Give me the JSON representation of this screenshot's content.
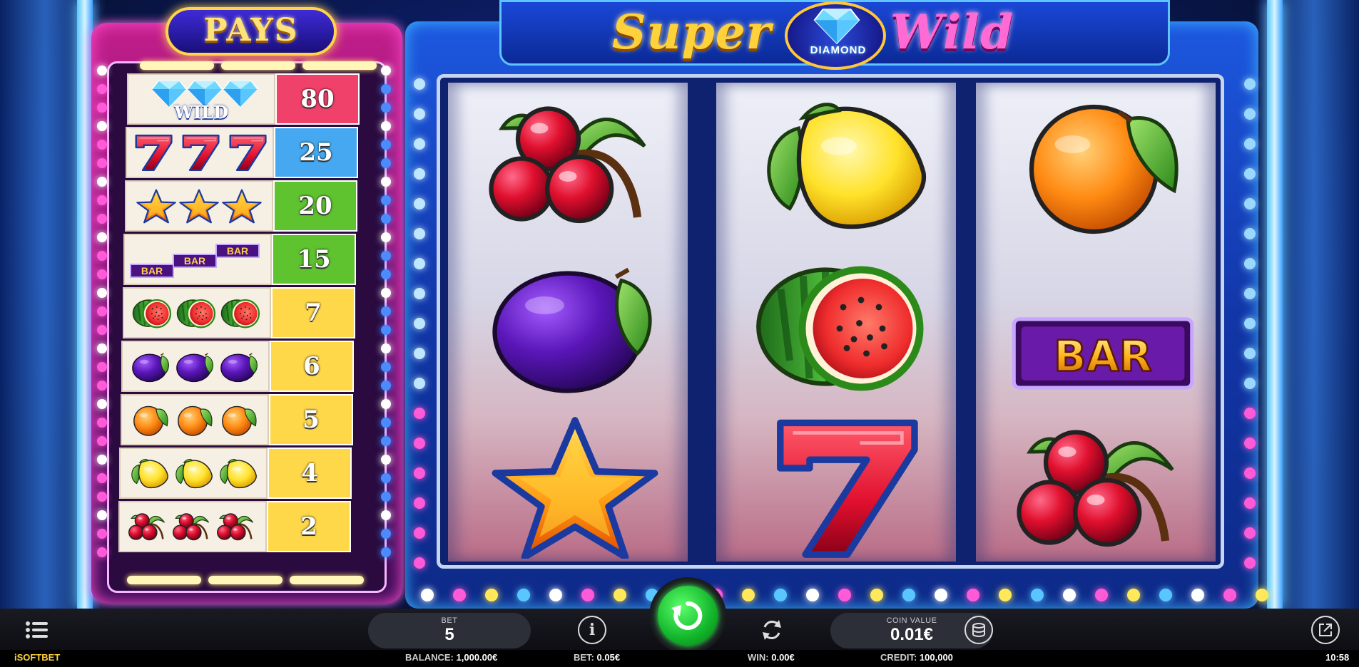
{
  "game": {
    "title_left": "Super",
    "title_center": "DIAMOND",
    "title_right": "Wild",
    "paytable_title": "PAYS"
  },
  "paytable": [
    {
      "symbol": "wild-diamond",
      "label": "WILD",
      "payout": "80",
      "color": "#f0416b"
    },
    {
      "symbol": "seven",
      "payout": "25",
      "color": "#45a8f0"
    },
    {
      "symbol": "star",
      "payout": "20",
      "color": "#5fc22f"
    },
    {
      "symbol": "bar",
      "label": "BAR",
      "payout": "15",
      "color": "#5fc22f"
    },
    {
      "symbol": "watermelon",
      "payout": "7",
      "color": "#ffd84a"
    },
    {
      "symbol": "plum",
      "payout": "6",
      "color": "#ffd84a"
    },
    {
      "symbol": "orange",
      "payout": "5",
      "color": "#ffd84a"
    },
    {
      "symbol": "lemon",
      "payout": "4",
      "color": "#ffd84a"
    },
    {
      "symbol": "cherry",
      "payout": "2",
      "color": "#ffd84a"
    }
  ],
  "reels": [
    [
      "cherry",
      "plum",
      "star"
    ],
    [
      "lemon",
      "watermelon",
      "seven"
    ],
    [
      "orange",
      "bar",
      "cherry"
    ]
  ],
  "reel_bar_label": "BAR",
  "controls": {
    "bet_label": "BET",
    "bet_value": "5",
    "coin_value_label": "COIN VALUE",
    "coin_value": "0.01€"
  },
  "status": {
    "brand": "iSOFTBET",
    "balance_label": "BALANCE:",
    "balance": "1,000.00€",
    "bet_label": "BET:",
    "bet": "0.05€",
    "win_label": "WIN:",
    "win": "0.00€",
    "credit_label": "CREDIT:",
    "credit": "100,000",
    "clock": "10:58"
  },
  "icons": [
    "menu-icon",
    "info-icon",
    "spin-icon",
    "autoplay-icon",
    "coins-icon",
    "external-link-icon"
  ]
}
